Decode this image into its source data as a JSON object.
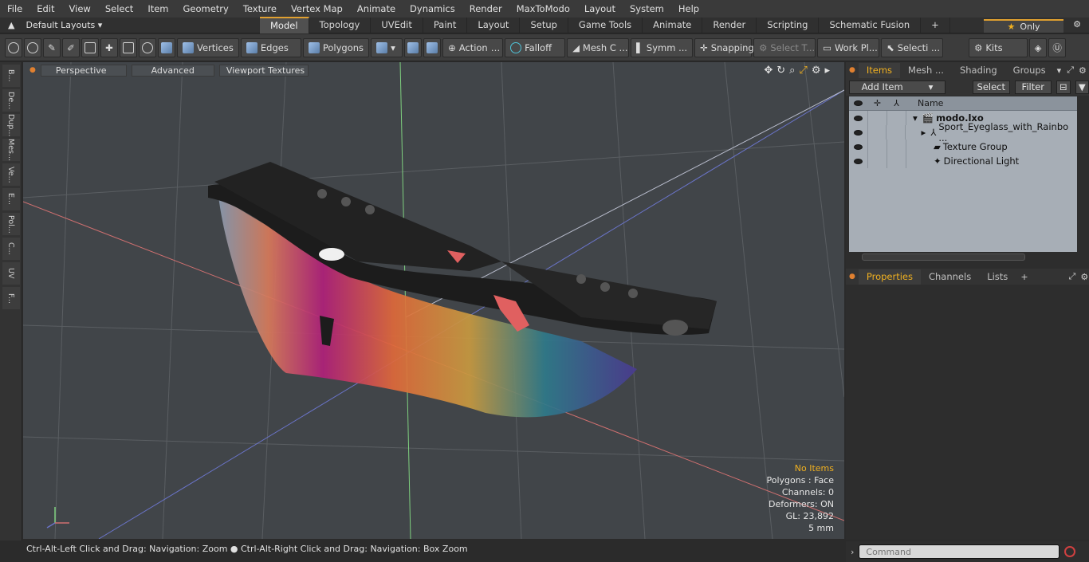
{
  "menu": [
    "File",
    "Edit",
    "View",
    "Select",
    "Item",
    "Geometry",
    "Texture",
    "Vertex Map",
    "Animate",
    "Dynamics",
    "Render",
    "MaxToModo",
    "Layout",
    "System",
    "Help"
  ],
  "layouts_label": "Default Layouts ▾",
  "tabs": [
    "Model",
    "Topology",
    "UVEdit",
    "Paint",
    "Layout",
    "Setup",
    "Game Tools",
    "Animate",
    "Render",
    "Scripting",
    "Schematic Fusion"
  ],
  "only_label": "Only",
  "toolbar": {
    "vertices": "Vertices",
    "edges": "Edges",
    "polygons": "Polygons",
    "action": "Action",
    "falloff": "Falloff",
    "mesh": "Mesh C ...",
    "symm": "Symm ...",
    "snapping": "Snapping",
    "select_t": "Select T...",
    "work_pl": "Work Pl...",
    "selecti": "Selecti ...",
    "kits": "Kits"
  },
  "left_strip": [
    "B...",
    "De...",
    "Dup...",
    "Mes...",
    "Ve...",
    "E...",
    "Pol...",
    "C...",
    "UV",
    "F..."
  ],
  "viewport": {
    "perspective": "Perspective",
    "advanced": "Advanced",
    "textures": "Viewport Textures",
    "stats": {
      "no_items": "No Items",
      "polygons": "Polygons : Face",
      "channels": "Channels: 0",
      "deformers": "Deformers: ON",
      "gl": "GL: 23,892",
      "unit": "5 mm"
    }
  },
  "status_text": "Ctrl-Alt-Left Click and Drag: Navigation: Zoom ● Ctrl-Alt-Right Click and Drag: Navigation: Box Zoom",
  "items_panel": {
    "tabs": [
      "Items",
      "Mesh ...",
      "Shading",
      "Groups"
    ],
    "add_item": "Add Item",
    "select": "Select",
    "filter": "Filter",
    "col_name": "Name",
    "rows": [
      "modo.lxo",
      "Sport_Eyeglass_with_Rainbo ...",
      "Texture Group",
      "Directional Light"
    ]
  },
  "props_panel": {
    "tabs": [
      "Properties",
      "Channels",
      "Lists"
    ]
  },
  "command_placeholder": "Command"
}
